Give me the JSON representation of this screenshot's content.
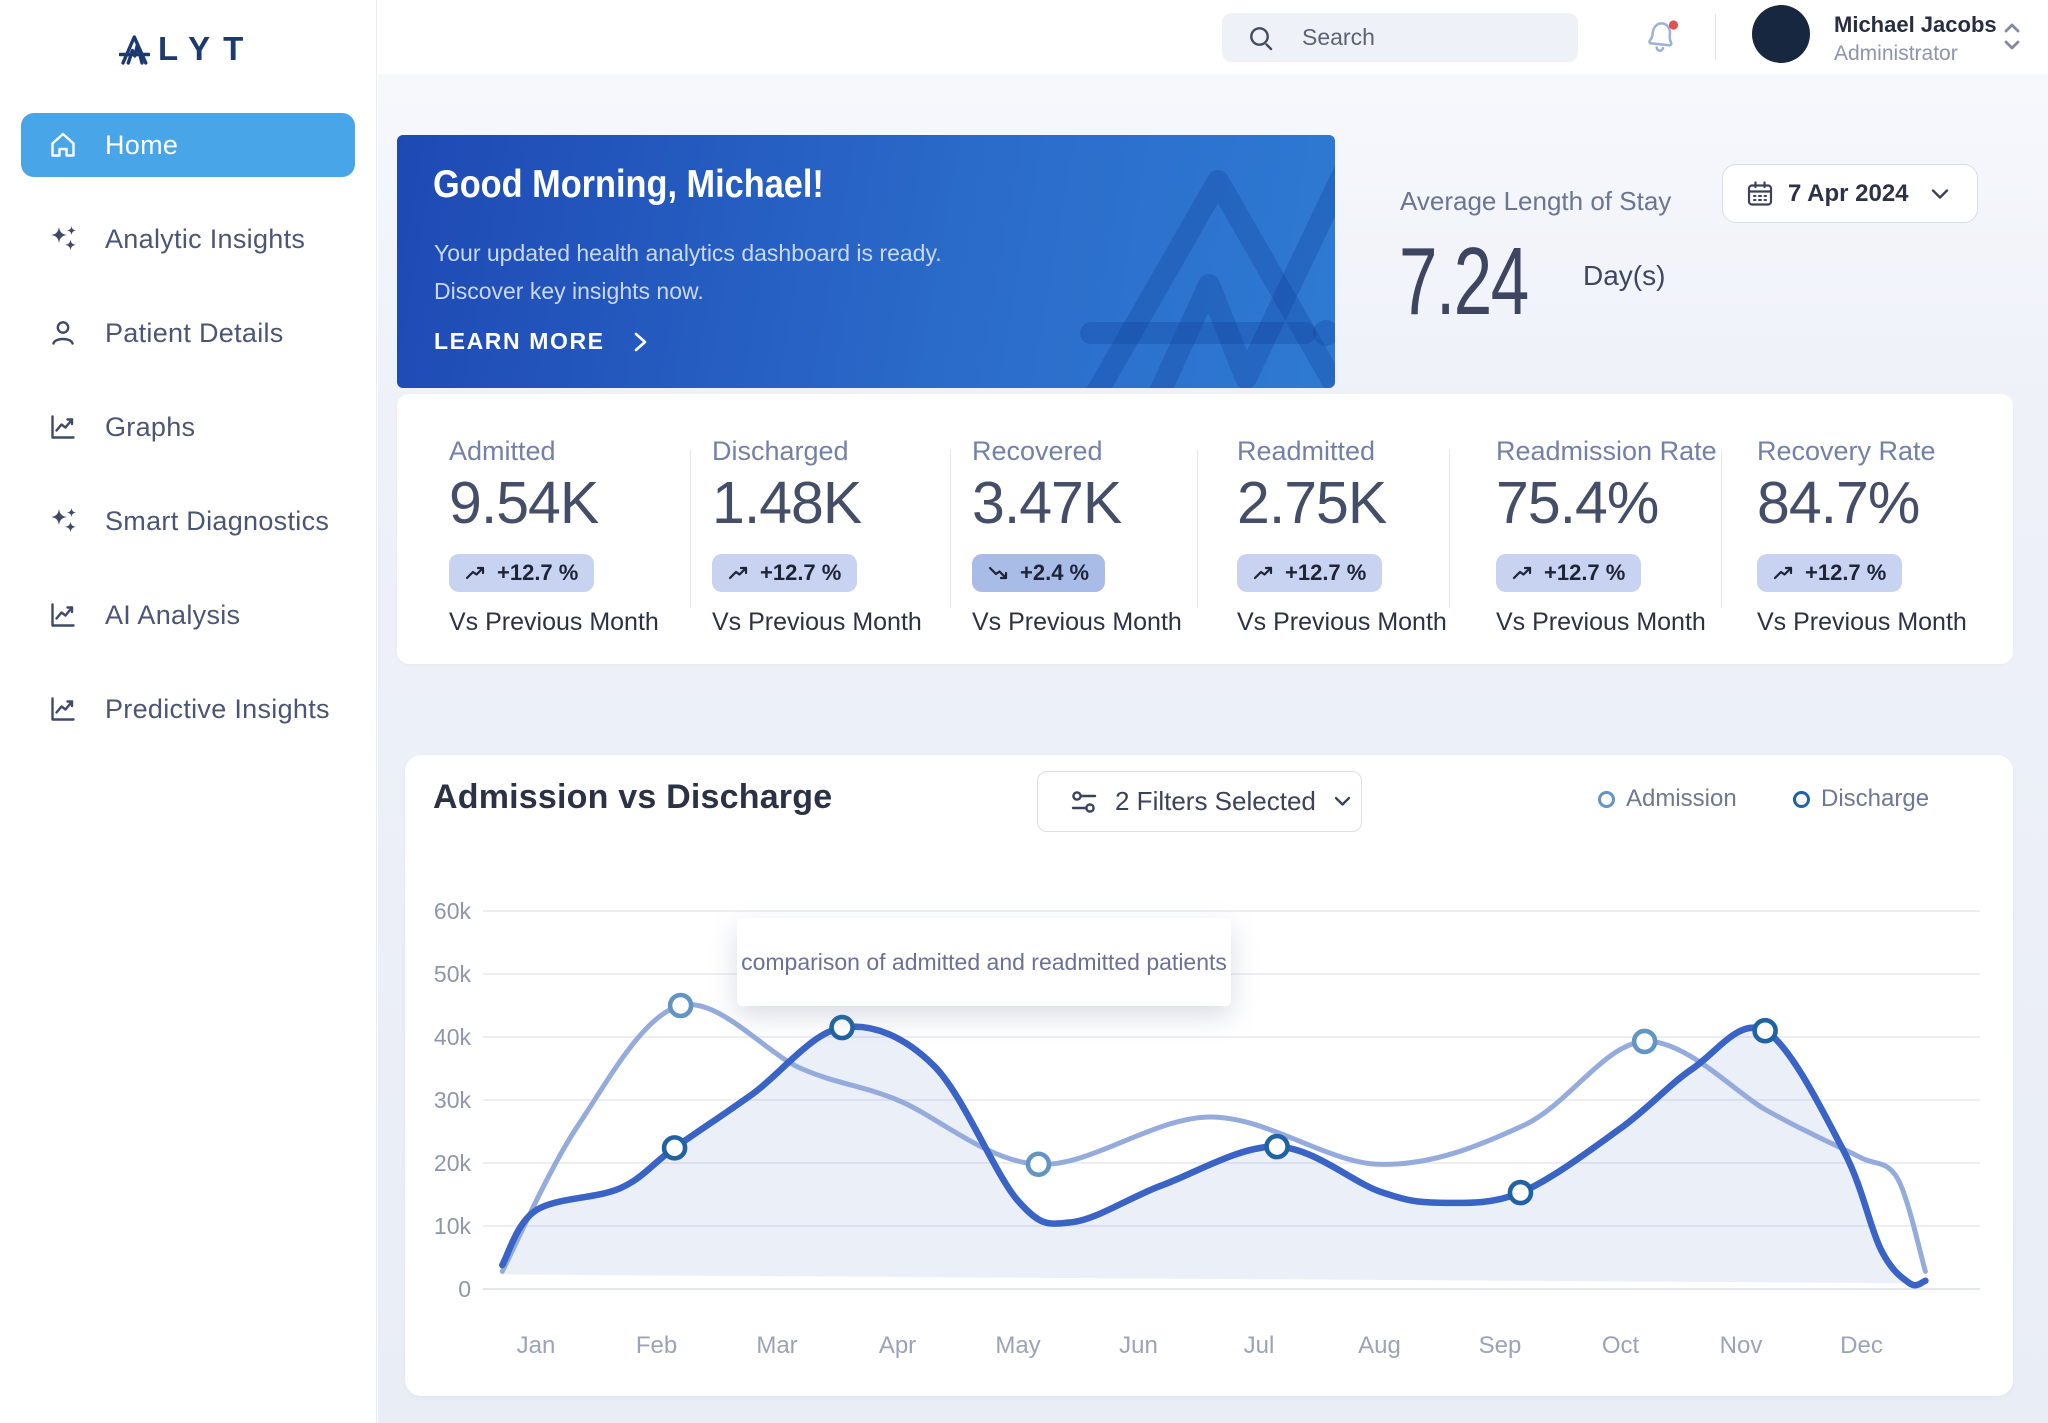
{
  "app": {
    "logo_text": "LYT"
  },
  "sidebar": {
    "items": [
      {
        "label": "Home",
        "icon": "home-icon",
        "active": true
      },
      {
        "label": "Analytic Insights",
        "icon": "sparkles-icon",
        "active": false
      },
      {
        "label": "Patient Details",
        "icon": "user-icon",
        "active": false
      },
      {
        "label": "Graphs",
        "icon": "chart-icon",
        "active": false
      },
      {
        "label": "Smart Diagnostics",
        "icon": "sparkles-icon",
        "active": false
      },
      {
        "label": "AI Analysis",
        "icon": "chart-icon",
        "active": false
      },
      {
        "label": "Predictive Insights",
        "icon": "chart-icon",
        "active": false
      }
    ]
  },
  "topbar": {
    "search_placeholder": "Search",
    "user": {
      "name": "Michael Jacobs",
      "role": "Administrator"
    }
  },
  "hero": {
    "greeting": "Good Morning, Michael!",
    "message_line1": "Your updated health analytics dashboard is ready.",
    "message_line2": "Discover key insights now.",
    "cta": "LEARN MORE"
  },
  "average_stay": {
    "label": "Average Length of Stay",
    "value": "7.24",
    "unit": "Day(s)",
    "date": "7 Apr 2024"
  },
  "stats": [
    {
      "label": "Admitted",
      "value": "9.54K",
      "delta": "+12.7 %",
      "trend": "up",
      "vs": "Vs Previous Month"
    },
    {
      "label": "Discharged",
      "value": "1.48K",
      "delta": "+12.7 %",
      "trend": "up",
      "vs": "Vs Previous Month"
    },
    {
      "label": "Recovered",
      "value": "3.47K",
      "delta": "+2.4 %",
      "trend": "down",
      "vs": "Vs Previous Month"
    },
    {
      "label": "Readmitted",
      "value": "2.75K",
      "delta": "+12.7 %",
      "trend": "up",
      "vs": "Vs Previous Month"
    },
    {
      "label": "Readmission Rate",
      "value": "75.4%",
      "delta": "+12.7 %",
      "trend": "up",
      "vs": "Vs Previous Month"
    },
    {
      "label": "Recovery Rate",
      "value": "84.7%",
      "delta": "+12.7 %",
      "trend": "up",
      "vs": "Vs Previous Month"
    }
  ],
  "chart": {
    "title": "Admission vs Discharge",
    "filter_label": "2 Filters Selected",
    "tooltip": "comparison of admitted and readmitted patients"
  },
  "chart_data": {
    "type": "line",
    "title": "Admission vs Discharge",
    "categories": [
      "Jan",
      "Feb",
      "Mar",
      "Apr",
      "May",
      "Jun",
      "Jul",
      "Aug",
      "Sep",
      "Oct",
      "Nov",
      "Dec"
    ],
    "y_ticks": [
      "0",
      "10k",
      "20k",
      "30k",
      "40k",
      "50k",
      "60k"
    ],
    "ylim": [
      0,
      60000
    ],
    "values_scale": 1000,
    "grid": true,
    "legend_position": "top-right",
    "fill_color": "rgba(104,130,202,0.13)",
    "baseline": [
      [
        -0.28,
        2.3
      ],
      [
        11.53,
        0.9
      ]
    ],
    "series": [
      {
        "name": "Admission",
        "color": "#94abdc",
        "marker_color": "#6295c2",
        "fill": false,
        "points": [
          [
            -0.28,
            2.8
          ],
          [
            0.35,
            26
          ],
          [
            1.2,
            45
          ],
          [
            2.2,
            35
          ],
          [
            3.0,
            30
          ],
          [
            4.17,
            19.8
          ],
          [
            5.6,
            27.3
          ],
          [
            7.0,
            19.8
          ],
          [
            8.2,
            26
          ],
          [
            9.2,
            39.3
          ],
          [
            10.2,
            28.5
          ],
          [
            10.6,
            24.5
          ],
          [
            11.0,
            20.8
          ],
          [
            11.3,
            17.5
          ],
          [
            11.53,
            2.8
          ]
        ],
        "markers": [
          [
            1.2,
            45
          ],
          [
            4.17,
            19.8
          ],
          [
            9.2,
            39.3
          ]
        ]
      },
      {
        "name": "Discharge",
        "color": "#3a63c6",
        "marker_color": "#1f63a2",
        "fill": true,
        "points": [
          [
            -0.28,
            3.8
          ],
          [
            0.0,
            12.5
          ],
          [
            0.7,
            16
          ],
          [
            1.15,
            22.4
          ],
          [
            1.8,
            31
          ],
          [
            2.54,
            41.5
          ],
          [
            3.3,
            35.5
          ],
          [
            4.0,
            14
          ],
          [
            4.45,
            10.6
          ],
          [
            5.2,
            16.5
          ],
          [
            6.15,
            22.6
          ],
          [
            7.0,
            15.5
          ],
          [
            7.5,
            13.7
          ],
          [
            8.17,
            15.3
          ],
          [
            9.0,
            25.5
          ],
          [
            9.6,
            35
          ],
          [
            10.2,
            41
          ],
          [
            10.85,
            22
          ],
          [
            11.16,
            6.3
          ],
          [
            11.4,
            0.9
          ],
          [
            11.53,
            1.3
          ]
        ],
        "markers": [
          [
            1.15,
            22.4
          ],
          [
            2.54,
            41.5
          ],
          [
            6.15,
            22.6
          ],
          [
            8.17,
            15.3
          ],
          [
            10.2,
            41
          ]
        ]
      }
    ]
  }
}
